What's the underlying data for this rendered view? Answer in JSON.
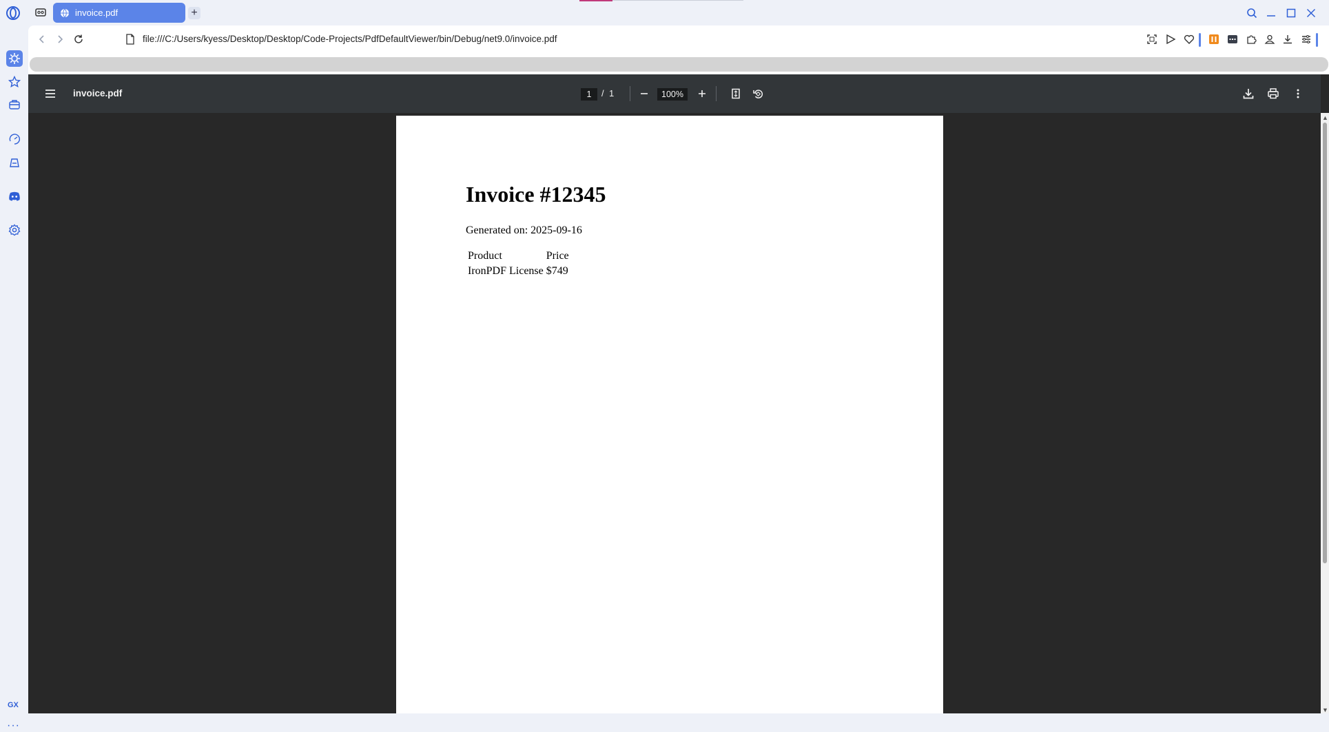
{
  "tab": {
    "title": "invoice.pdf",
    "new_tab": "+"
  },
  "addressbar": {
    "url": "file:///C:/Users/kyess/Desktop/Desktop/Code-Projects/PdfDefaultViewer/bin/Debug/net9.0/invoice.pdf"
  },
  "sidebar": {
    "gx_label": "GX",
    "more_label": "···"
  },
  "viewer": {
    "title": "invoice.pdf",
    "current_page": "1",
    "page_separator": "/",
    "total_pages": "1",
    "zoom": "100%"
  },
  "document": {
    "heading": "Invoice #12345",
    "generated": "Generated on: 2025-09-16",
    "table": {
      "headers": [
        "Product",
        "Price"
      ],
      "rows": [
        [
          "IronPDF License",
          "$749"
        ]
      ]
    }
  },
  "colors": {
    "accent": "#5b84e8",
    "toolbar": "#323639",
    "viewer_bg": "#282828"
  }
}
